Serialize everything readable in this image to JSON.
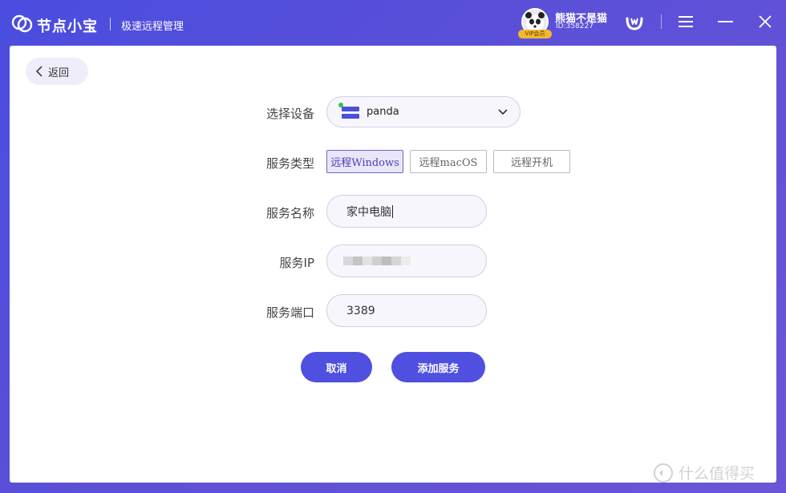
{
  "app": {
    "brand": "节点小宝",
    "subtitle": "极速远程管理"
  },
  "user": {
    "name": "熊猫不是猫",
    "id": "ID:358227",
    "vip_badge": "VIP会员"
  },
  "back": {
    "label": "返回"
  },
  "form": {
    "device_label": "选择设备",
    "device_value": "panda",
    "service_type_label": "服务类型",
    "service_types": [
      "远程Windows",
      "远程macOS",
      "远程开机"
    ],
    "service_type_selected": "远程Windows",
    "service_name_label": "服务名称",
    "service_name_value": "家中电脑",
    "service_ip_label": "服务IP",
    "service_port_label": "服务端口",
    "service_port_value": "3389"
  },
  "actions": {
    "cancel": "取消",
    "add": "添加服务"
  },
  "watermark": "什么值得买",
  "colors": {
    "accent": "#4f4fe0",
    "titlebar": "#5a4fd8",
    "online": "#2cc84a",
    "vip": "#f2b630"
  },
  "icons": [
    "logo-icon",
    "w-logo-icon",
    "menu-icon",
    "minimize-icon",
    "close-icon",
    "back-chevron-icon",
    "server-icon",
    "chevron-down-icon"
  ]
}
